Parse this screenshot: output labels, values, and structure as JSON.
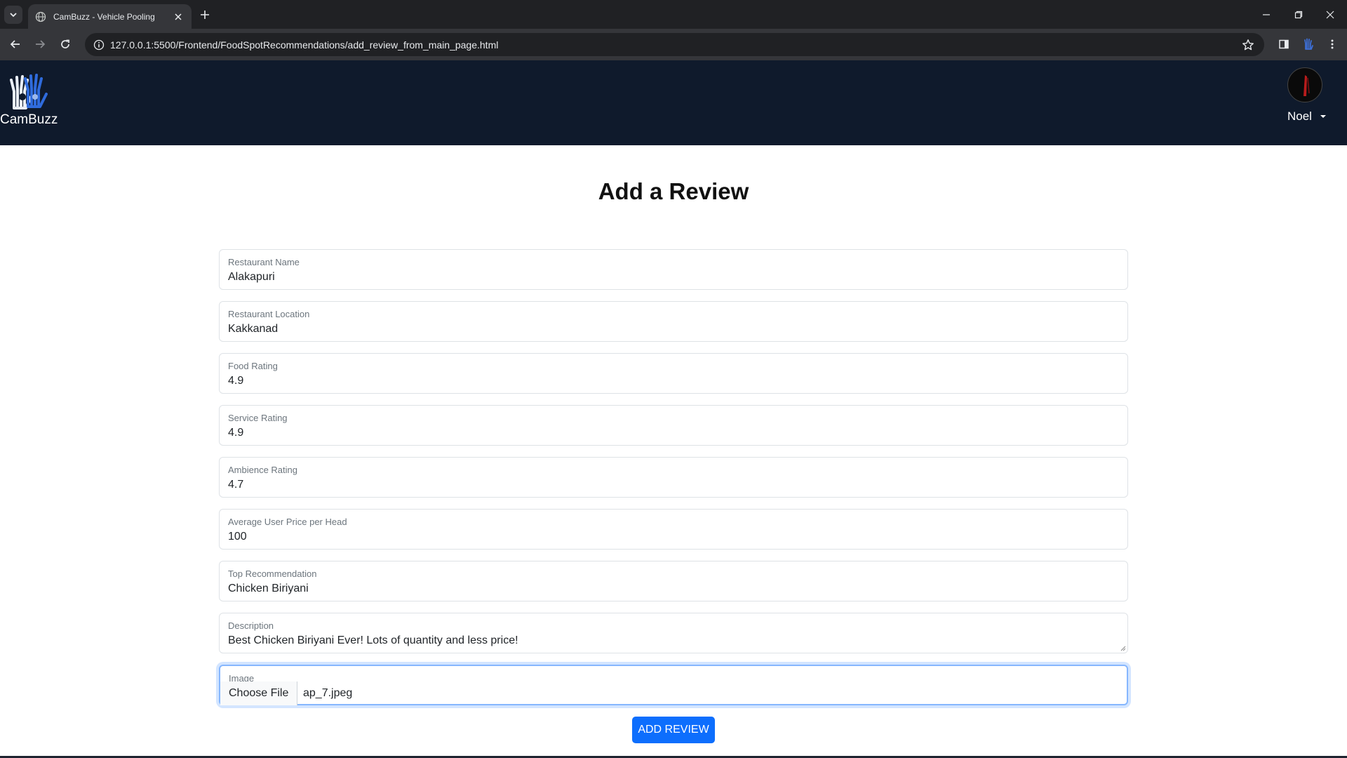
{
  "browser": {
    "tab_title": "CamBuzz - Vehicle Pooling",
    "url": "127.0.0.1:5500/Frontend/FoodSpotRecommendations/add_review_from_main_page.html"
  },
  "navbar": {
    "brand": "CamBuzz",
    "user_name": "Noel"
  },
  "page": {
    "title": "Add a Review"
  },
  "form": {
    "fields": [
      {
        "label": "Restaurant Name",
        "value": "Alakapuri"
      },
      {
        "label": "Restaurant Location",
        "value": "Kakkanad"
      },
      {
        "label": "Food Rating",
        "value": "4.9"
      },
      {
        "label": "Service Rating",
        "value": "4.9"
      },
      {
        "label": "Ambience Rating",
        "value": "4.7"
      },
      {
        "label": "Average User Price per Head",
        "value": "100"
      },
      {
        "label": "Top Recommendation",
        "value": "Chicken Biriyani"
      },
      {
        "label": "Description",
        "value": "Best Chicken Biriyani Ever! Lots of quantity and less price!"
      }
    ],
    "image": {
      "label": "Image",
      "button": "Choose File",
      "file_name": "ap_7.jpeg"
    },
    "submit_label": "ADD REVIEW"
  },
  "colors": {
    "navbar_bg": "#0f1a2c",
    "primary": "#0d6efd",
    "focus_ring": "#86b7fe"
  },
  "icons": [
    "tab-search-icon",
    "globe-icon",
    "close-icon",
    "plus-icon",
    "minimize-icon",
    "restore-icon",
    "back-icon",
    "forward-icon",
    "reload-icon",
    "info-icon",
    "star-icon",
    "side-panel-icon",
    "extension-icon",
    "menu-icon",
    "hand-logo-icon",
    "caret-down-icon"
  ]
}
